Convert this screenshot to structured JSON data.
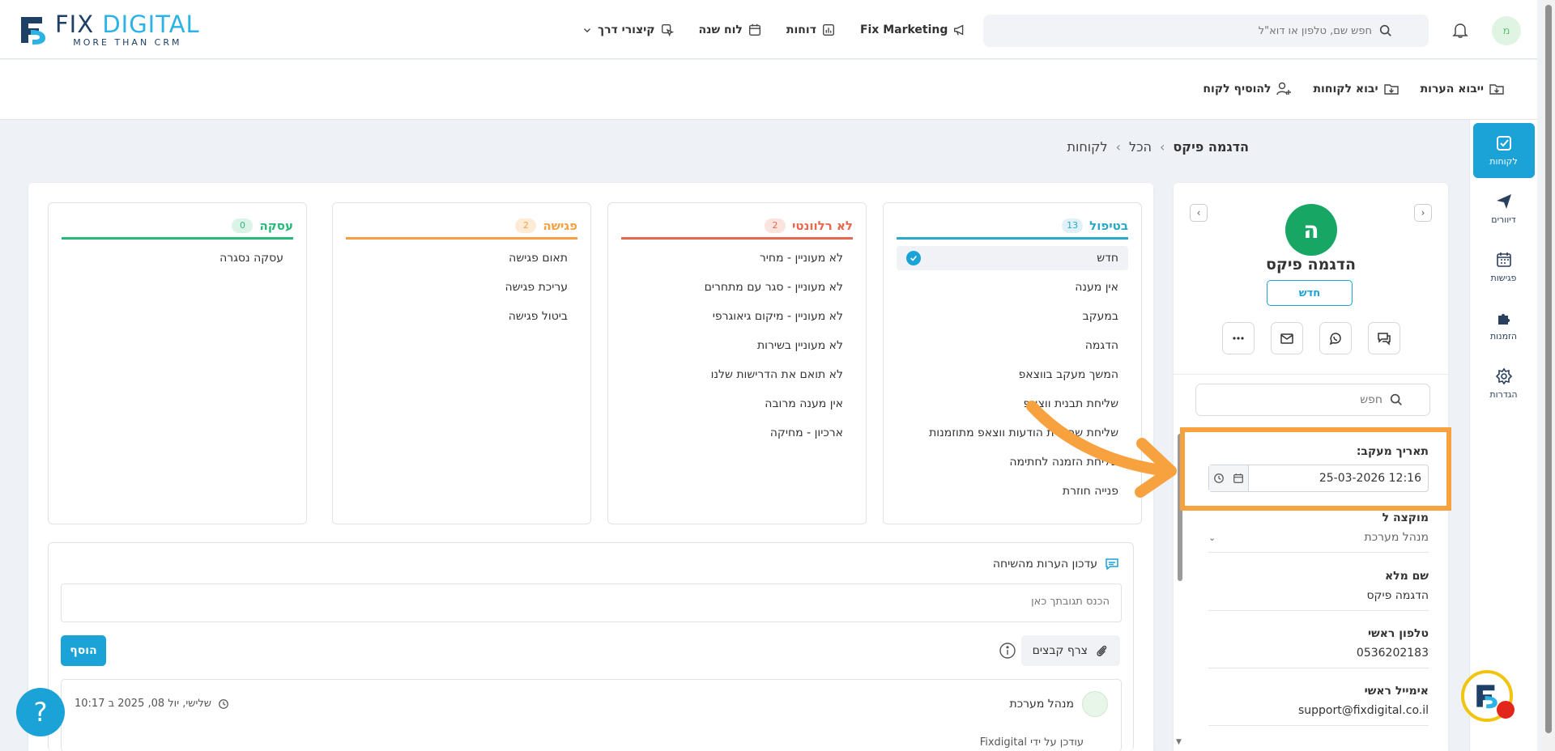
{
  "brand": {
    "logo_fix": "FIX",
    "logo_digital": "DIGITAL",
    "logo_tagline": "MORE THAN CRM"
  },
  "topnav": {
    "items": [
      {
        "label": "קיצורי דרך"
      },
      {
        "label": "לוח שנה"
      },
      {
        "label": "דוחות"
      },
      {
        "label": "Fix Marketing"
      }
    ],
    "search_placeholder": "חפש שם, טלפון או דוא\"ל",
    "avatar_initial": "מ"
  },
  "toolbar": {
    "add_customer": "להוסיף לקוח",
    "import_customers": "יבוא לקוחות",
    "import_notes": "ייבוא הערות"
  },
  "rail": {
    "items": [
      {
        "label": "לקוחות"
      },
      {
        "label": "דיוורים"
      },
      {
        "label": "פגישות"
      },
      {
        "label": "הזמנות"
      },
      {
        "label": "הגדרות"
      }
    ]
  },
  "breadcrumb": {
    "root": "לקוחות",
    "sep1": "›",
    "mid": "הכל",
    "sep2": "›",
    "current": "הדגמה פיקס"
  },
  "contact": {
    "initial": "ה",
    "name": "הדגמה פיקס",
    "status": "חדש",
    "search_placeholder": "חפש",
    "followup_label": "תאריך מעקב:",
    "followup_value": "25-03-2026 12:16",
    "assigned_label": "מוקצה ל",
    "assigned_value": "מנהל מערכת",
    "fullname_label": "שם מלא",
    "fullname_value": "הדגמה פיקס",
    "phone_label": "טלפון ראשי",
    "phone_value": "0536202183",
    "email_label": "אימייל ראשי",
    "email_value": "support@fixdigital.co.il"
  },
  "pipeline": {
    "columns": [
      {
        "title": "בטיפול",
        "count": "13",
        "color": "#29a8c7",
        "items": [
          "חדש",
          "אין מענה",
          "במעקב",
          "הדגמה",
          "המשך מעקב בווצאפ",
          "שליחת תבנית ווצאפ",
          "שליחת שרשרת הודעות ווצאפ מתוזמנות",
          "שליחת הזמנה לחתימה",
          "פנייה חוזרת"
        ]
      },
      {
        "title": "לא רלוונטי",
        "count": "2",
        "color": "#e8684d",
        "items": [
          "לא מעוניין - מחיר",
          "לא מעוניין - סגר עם מתחרים",
          "לא מעוניין - מיקום גיאוגרפי",
          "לא מעוניין בשירות",
          "לא תואם את הדרישות שלנו",
          "אין מענה מרובה",
          "ארכיון - מחיקה"
        ]
      },
      {
        "title": "פגישה",
        "count": "2",
        "color": "#f5a142",
        "items": [
          "תאום פגישה",
          "עריכת פגישה",
          "ביטול פגישה"
        ]
      },
      {
        "title": "עסקה",
        "count": "0",
        "color": "#26b97a",
        "items": [
          "עסקה נסגרה"
        ]
      }
    ]
  },
  "notes": {
    "title": "עדכון הערות מהשיחה",
    "placeholder": "הכנס תגובתך כאן",
    "add": "הוסף",
    "attach": "צרף קבצים",
    "entry_user": "מנהל מערכת",
    "entry_date": "שלישי, יול 08, 2025 ב 10:17",
    "entry_by": "עודכן על ידי Fixdigital"
  },
  "help": {
    "label": "?"
  }
}
